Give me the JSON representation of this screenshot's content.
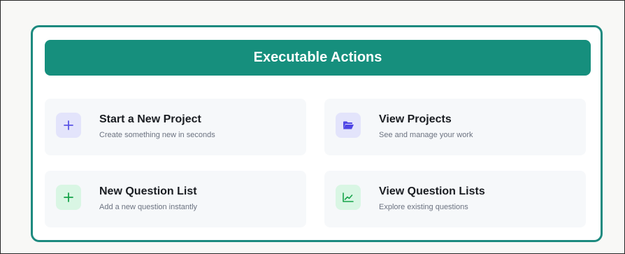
{
  "panel": {
    "header": "Executable Actions",
    "actions": [
      {
        "title": "Start a New Project",
        "subtitle": "Create something new in seconds",
        "icon": "plus-icon",
        "accent": "#5b55e6"
      },
      {
        "title": "View Projects",
        "subtitle": "See and manage your work",
        "icon": "folder-open-icon",
        "accent": "#4f46e5"
      },
      {
        "title": "New Question List",
        "subtitle": "Add a new question instantly",
        "icon": "plus-icon",
        "accent": "#16a34a"
      },
      {
        "title": "View Question Lists",
        "subtitle": "Explore existing questions",
        "icon": "line-chart-icon",
        "accent": "#16a34a"
      }
    ]
  },
  "colors": {
    "panel_border": "#1d8a7f",
    "header_bg": "#168f7d",
    "card_bg": "#f6f8fa",
    "purple_icon_bg": "#e3e4fb",
    "green_icon_bg": "#d9f6e4"
  }
}
